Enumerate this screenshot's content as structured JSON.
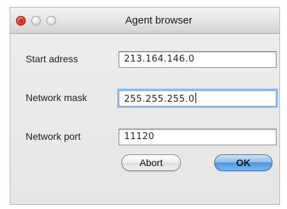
{
  "window": {
    "title": "Agent browser"
  },
  "form": {
    "start_address": {
      "label": "Start adress",
      "value": "213.164.146.0"
    },
    "network_mask": {
      "label": "Network mask",
      "value": "255.255.255.0"
    },
    "network_port": {
      "label": "Network port",
      "value": "11120"
    }
  },
  "buttons": {
    "abort_label": "Abort",
    "ok_label": "OK"
  },
  "colors": {
    "close_button": "#e2402c",
    "focus_ring": "#9cc0ea",
    "default_button": "#4f94dc"
  }
}
